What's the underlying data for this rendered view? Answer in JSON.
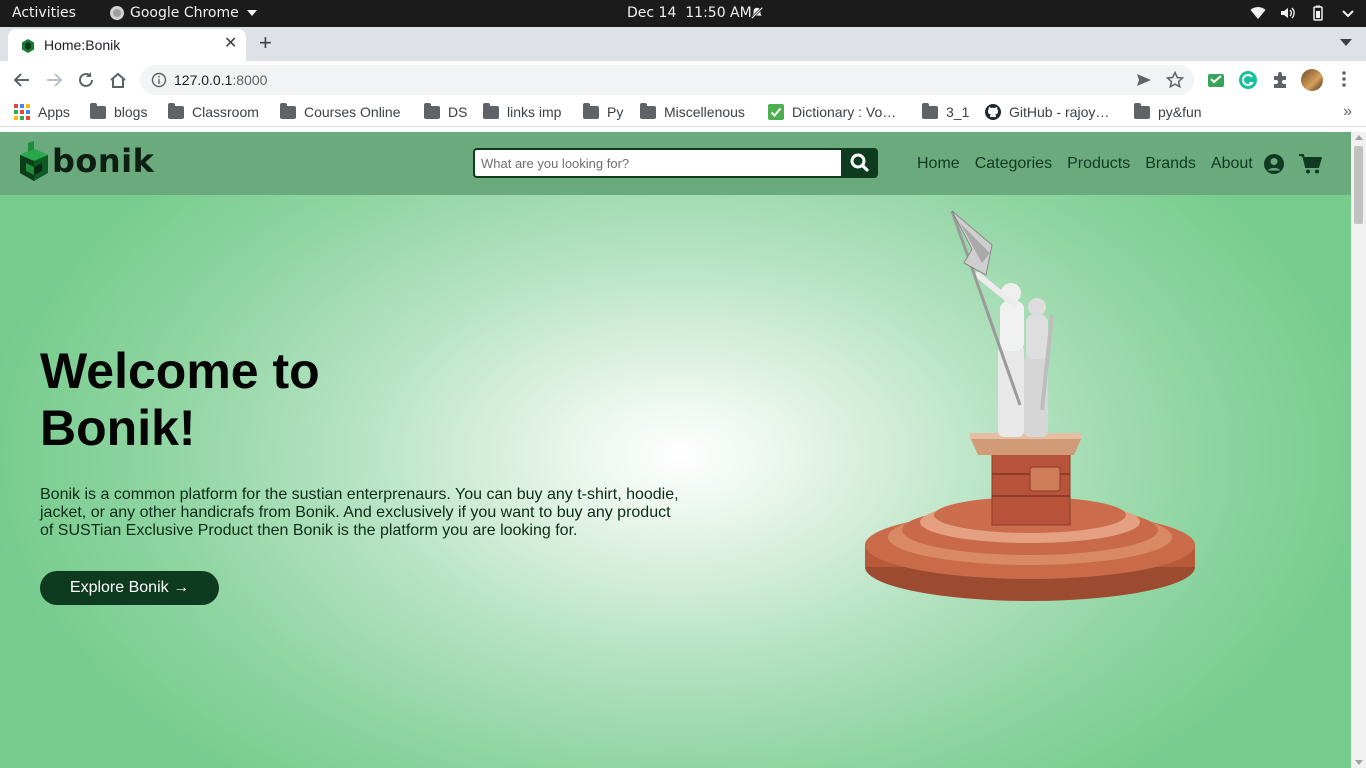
{
  "system_bar": {
    "activities": "Activities",
    "app_name": "Google Chrome",
    "date": "Dec 14",
    "time": "11:50 AM"
  },
  "browser": {
    "tab": {
      "title": "Home:Bonik",
      "close": "✕"
    },
    "new_tab": "+",
    "url_host": "127.0.0.1",
    "url_port": ":8000",
    "bookmarks": [
      "Apps",
      "blogs",
      "Classroom",
      "Courses Online",
      "DS",
      "links imp",
      "Py",
      "Miscellenous",
      "Dictionary : Vo…",
      "3_1",
      "GitHub - rajoy…",
      "py&fun"
    ],
    "bookmarks_more": "»"
  },
  "site": {
    "brand": "bonik",
    "search": {
      "placeholder": "What are you looking for?"
    },
    "nav": [
      "Home",
      "Categories",
      "Products",
      "Brands",
      "About"
    ],
    "colors": {
      "navbar": "#6aaa7d",
      "dark_green": "#0e3a20",
      "hero_center": "#ffffff",
      "hero_edge": "#76cb8d"
    }
  },
  "hero": {
    "title_line1": "Welcome to",
    "title_line2": "Bonik!",
    "description": "Bonik is a common platform for the sustian enterprenaurs. You can buy any t-shirt, hoodie, jacket, or any other handicrafs from Bonik. And exclusively if you want to buy any product of SUSTian Exclusive Product then Bonik is the platform you are looking for.",
    "cta": "Explore Bonik →"
  }
}
